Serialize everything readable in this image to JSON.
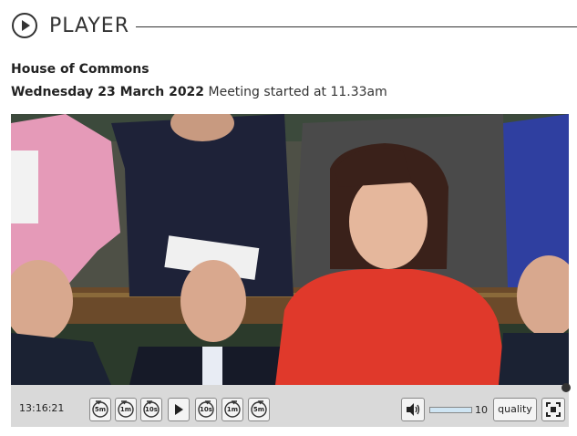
{
  "header": {
    "title": "PLAYER",
    "icon": "play-circle-icon"
  },
  "meeting": {
    "house": "House of Commons",
    "date": "Wednesday 23 March 2022",
    "started": "Meeting started at 11.33am"
  },
  "player": {
    "current_time": "13:16:21",
    "skip_back": [
      {
        "label": "5m",
        "icon": "rewind-5m-icon"
      },
      {
        "label": "1m",
        "icon": "rewind-1m-icon"
      },
      {
        "label": "10s",
        "icon": "rewind-10s-icon"
      }
    ],
    "play": {
      "icon": "play-icon"
    },
    "skip_forward": [
      {
        "label": "10s",
        "icon": "forward-10s-icon"
      },
      {
        "label": "1m",
        "icon": "forward-1m-icon"
      },
      {
        "label": "5m",
        "icon": "forward-5m-icon"
      }
    ],
    "volume": {
      "icon": "speaker-icon",
      "value": "10",
      "level": 1.0
    },
    "quality_label": "quality",
    "fullscreen": {
      "icon": "fullscreen-icon"
    },
    "progress": 1.0
  },
  "colors": {
    "controls_bg": "#d9d9d9",
    "volume_bar": "#b7d3e6",
    "speaker_dress": "#e0392b"
  }
}
